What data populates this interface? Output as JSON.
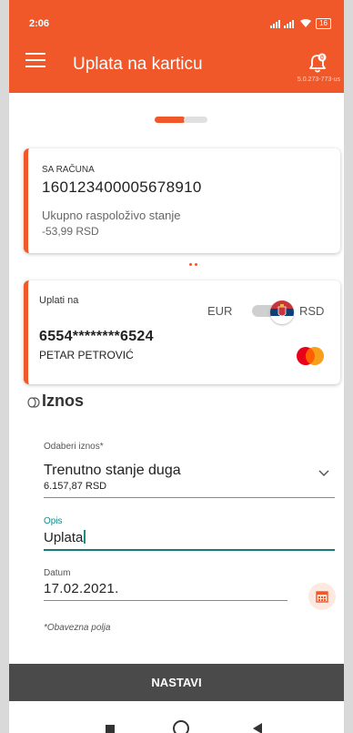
{
  "status_bar": {
    "time": "2:06",
    "battery": "16",
    "version": "5.0.273-773-us"
  },
  "header": {
    "title": "Uplata na karticu",
    "bell_badge": "0"
  },
  "source_account": {
    "label": "SA RAČUNA",
    "number": "160123400005678910",
    "balance_label": "Ukupno raspoloživo stanje",
    "balance": "-53,99 RSD"
  },
  "target_card": {
    "label": "Uplati na",
    "currency_left": "EUR",
    "currency_right": "RSD",
    "number": "6554********6524",
    "holder": "PETAR PETROVIĆ"
  },
  "amount_section": {
    "title": "Iznos",
    "amount_label": "Odaberi iznos*",
    "amount_value": "Trenutno stanje duga",
    "amount_sub": "6.157,87 RSD",
    "description_label": "Opis",
    "description_value": "Uplata",
    "date_label": "Datum",
    "date_value": "17.02.2021.",
    "required_note": "*Obavezna polja"
  },
  "actions": {
    "next_label": "NASTAVI"
  },
  "colors": {
    "brand": "#f0582a",
    "focus": "#1a8a8a",
    "action_bar": "#4a4a4a"
  }
}
